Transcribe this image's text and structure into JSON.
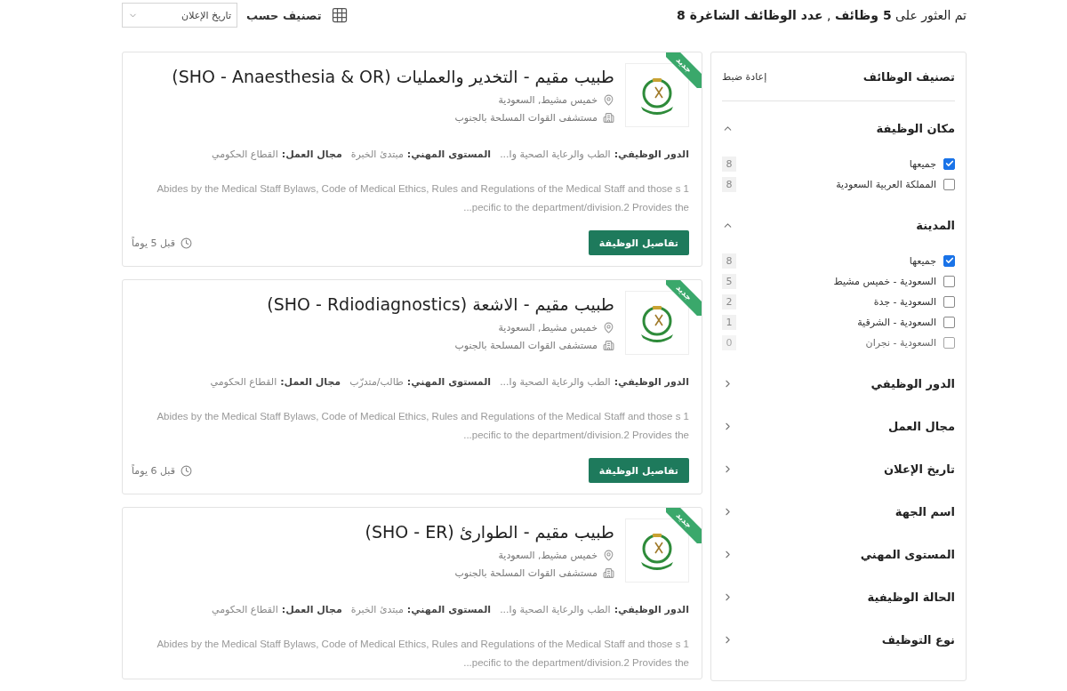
{
  "header": {
    "summary": "تم العثور على **5 وظائف** , **عدد الوظائف الشاغرة 8**",
    "sort_label": "تصنيف حسب",
    "sort_value": "تاريخ الإعلان"
  },
  "jobs": [
    {
      "badge": "جديد",
      "title": "طبيب مقيم - التخدير والعمليات (SHO - Anaesthesia & OR)",
      "location": "خميس مشيط, السعودية",
      "organization": "مستشفى القوات المسلحة بالجنوب",
      "meta": [
        {
          "label": "الدور الوظيفي:",
          "value": "الطب والرعاية الصحية وا..."
        },
        {
          "label": "المستوى المهني:",
          "value": "مبتدئ الخبرة"
        },
        {
          "label": "مجال العمل:",
          "value": "القطاع الحكومي"
        }
      ],
      "description_lines": [
        "Abides by the Medical Staff Bylaws, Code of Medical Ethics, Rules and Regulations of the Medical Staff and those s 1",
        "...pecific to the department/division.2 Provides the"
      ],
      "button": "تفاصيل الوظيفة",
      "posted": "قبل 5 يوماً"
    },
    {
      "badge": "جديد",
      "title": "طبيب مقيم - الاشعة (SHO - Rdiodiagnostics)",
      "location": "خميس مشيط, السعودية",
      "organization": "مستشفى القوات المسلحة بالجنوب",
      "meta": [
        {
          "label": "الدور الوظيفي:",
          "value": "الطب والرعاية الصحية وا..."
        },
        {
          "label": "المستوى المهني:",
          "value": "طالب/متدرّب"
        },
        {
          "label": "مجال العمل:",
          "value": "القطاع الحكومي"
        }
      ],
      "description_lines": [
        "Abides by the Medical Staff Bylaws, Code of Medical Ethics, Rules and Regulations of the Medical Staff and those s 1",
        "...pecific to the department/division.2 Provides the"
      ],
      "button": "تفاصيل الوظيفة",
      "posted": "قبل 6 يوماً"
    },
    {
      "badge": "جديد",
      "title": "طبيب مقيم - الطوارئ (SHO - ER)",
      "location": "خميس مشيط, السعودية",
      "organization": "مستشفى القوات المسلحة بالجنوب",
      "meta": [
        {
          "label": "الدور الوظيفي:",
          "value": "الطب والرعاية الصحية وا..."
        },
        {
          "label": "المستوى المهني:",
          "value": "مبتدئ الخبرة"
        },
        {
          "label": "مجال العمل:",
          "value": "القطاع الحكومي"
        }
      ],
      "description_lines": [
        "Abides by the Medical Staff Bylaws, Code of Medical Ethics, Rules and Regulations of the Medical Staff and those s 1",
        "...pecific to the department/division.2 Provides the"
      ]
    }
  ],
  "filters": {
    "title": "تصنيف الوظائف",
    "reset": "إعادة ضبط",
    "sections": [
      {
        "title": "مكان الوظيفة",
        "expanded": true,
        "options": [
          {
            "label": "جميعها",
            "count": "8",
            "checked": true,
            "disabled": false
          },
          {
            "label": "المملكة العربية السعودية",
            "count": "8",
            "checked": false,
            "disabled": false
          }
        ]
      },
      {
        "title": "المدينة",
        "expanded": true,
        "options": [
          {
            "label": "جميعها",
            "count": "8",
            "checked": true,
            "disabled": false
          },
          {
            "label": "السعودية - خميس مشيط",
            "count": "5",
            "checked": false,
            "disabled": false
          },
          {
            "label": "السعودية - جدة",
            "count": "2",
            "checked": false,
            "disabled": false
          },
          {
            "label": "السعودية - الشرقية",
            "count": "1",
            "checked": false,
            "disabled": false
          },
          {
            "label": "السعودية - نجران",
            "count": "0",
            "checked": false,
            "disabled": true
          }
        ]
      },
      {
        "title": "الدور الوظيفي",
        "expanded": false
      },
      {
        "title": "مجال العمل",
        "expanded": false
      },
      {
        "title": "تاريخ الإعلان",
        "expanded": false
      },
      {
        "title": "اسم الجهة",
        "expanded": false
      },
      {
        "title": "المستوى المهني",
        "expanded": false
      },
      {
        "title": "الحالة الوظيفية",
        "expanded": false
      },
      {
        "title": "نوع التوظيف",
        "expanded": false
      }
    ]
  }
}
